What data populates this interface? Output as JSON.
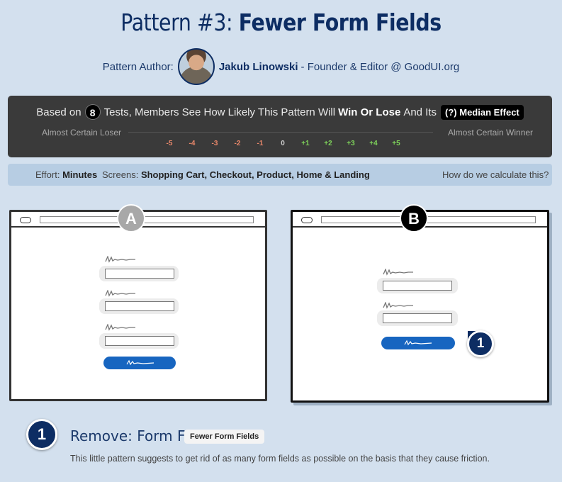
{
  "title": {
    "prefix": "Pattern #3:",
    "name": "Fewer Form Fields"
  },
  "author": {
    "label": "Pattern Author:",
    "name": "Jakub Linowski",
    "role": "- Founder & Editor @ GoodUI.org"
  },
  "summary": {
    "based_on": "Based on",
    "tests_count": "8",
    "middle": "Tests, Members See How Likely This Pattern Will",
    "win_or_lose": "Win Or Lose",
    "and_its": "And Its",
    "median_effect": "(?) Median Effect",
    "left_label": "Almost Certain Loser",
    "right_label": "Almost Certain Winner",
    "ticks": [
      "-5",
      "-4",
      "-3",
      "-2",
      "-1",
      "0",
      "+1",
      "+2",
      "+3",
      "+4",
      "+5"
    ]
  },
  "meta": {
    "effort_label": "Effort:",
    "effort_value": "Minutes",
    "screens_label": "Screens:",
    "screens_value": "Shopping Cart, Checkout, Product, Home & Landing",
    "how_link": "How do we calculate this?"
  },
  "variants": {
    "a_label": "A",
    "b_label": "B",
    "marker": "1"
  },
  "change": {
    "number": "1",
    "title": "Remove: Form Fields",
    "tag": "Fewer Form Fields",
    "description": "This little pattern suggests to get rid of as many form fields as possible on the basis that they cause friction."
  },
  "colors": {
    "primary": "#0d2d63",
    "background": "#d3e0ee",
    "panel": "#3a3a3a",
    "button": "#1765c0"
  }
}
